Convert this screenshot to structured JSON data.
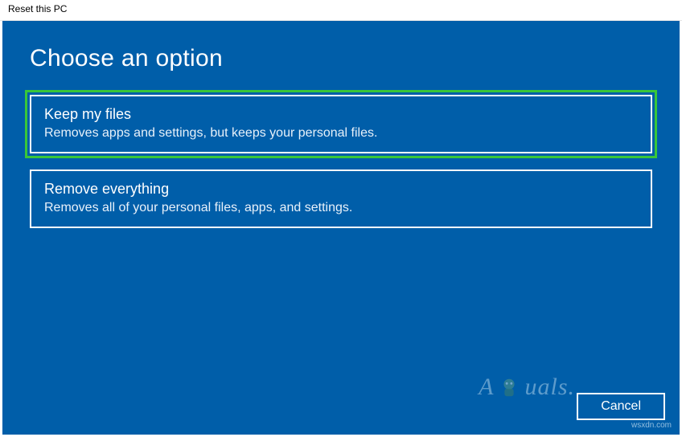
{
  "window": {
    "title": "Reset this PC"
  },
  "heading": "Choose an option",
  "options": [
    {
      "title": "Keep my files",
      "description": "Removes apps and settings, but keeps your personal files.",
      "highlighted": true
    },
    {
      "title": "Remove everything",
      "description": "Removes all of your personal files, apps, and settings.",
      "highlighted": false
    }
  ],
  "footer": {
    "cancel_label": "Cancel"
  },
  "watermark": {
    "brand": "A   uals",
    "url": "wsxdn.com"
  }
}
